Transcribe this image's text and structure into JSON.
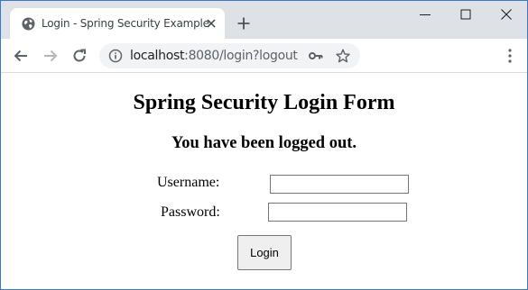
{
  "browser": {
    "tab": {
      "title": "Login - Spring Security Example",
      "favicon": "globe-icon"
    },
    "url": {
      "host": "localhost",
      "rest": ":8080/login?logout"
    },
    "icons": {
      "back": "arrow-left-icon",
      "forward": "arrow-right-icon",
      "reload": "reload-icon",
      "site_info": "info-icon",
      "passwords": "key-icon",
      "bookmark": "star-icon",
      "menu": "kebab-menu-icon",
      "new_tab": "plus-icon",
      "minimize": "minimize-icon",
      "maximize": "maximize-icon",
      "close": "close-icon"
    },
    "colors": {
      "frame": "#dee1e6",
      "omnibox": "#f1f3f4",
      "window_border": "#3c78c8"
    }
  },
  "page": {
    "heading": "Spring Security Login Form",
    "message": "You have been logged out.",
    "form": {
      "username_label": "Username:",
      "username_value": "",
      "password_label": "Password:",
      "password_value": "",
      "submit_label": "Login"
    }
  }
}
